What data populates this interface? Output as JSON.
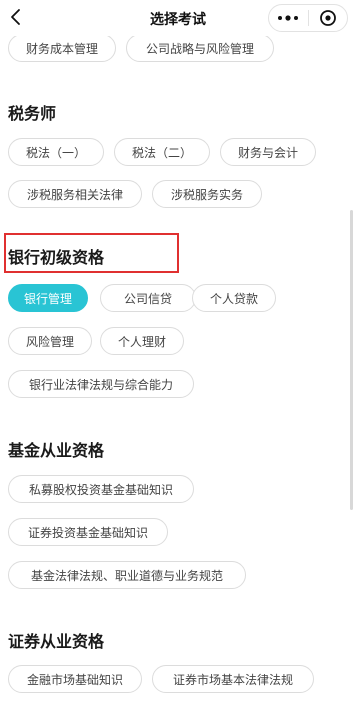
{
  "header": {
    "title": "选择考试",
    "back_icon": "chevron-left-icon",
    "more_icon": "more-dots-icon",
    "close_icon": "target-circle-icon"
  },
  "colors": {
    "selected": "#29c4d4",
    "highlight": "#e03030"
  },
  "top_partial": {
    "pills": [
      "财务成本管理",
      "公司战略与风险管理"
    ]
  },
  "sections": [
    {
      "title": "税务师",
      "pills": [
        "税法（一）",
        "税法（二）",
        "财务与会计",
        "涉税服务相关法律",
        "涉税服务实务"
      ]
    },
    {
      "title": "银行初级资格",
      "pills": [
        "银行管理",
        "公司信贷",
        "个人贷款",
        "风险管理",
        "个人理财",
        "银行业法律法规与综合能力"
      ],
      "selected": "银行管理"
    },
    {
      "title": "基金从业资格",
      "pills": [
        "私募股权投资基金基础知识",
        "证券投资基金基础知识",
        "基金法律法规、职业道德与业务规范"
      ]
    },
    {
      "title": "证券从业资格",
      "pills": [
        "金融市场基础知识",
        "证券市场基本法律法规"
      ]
    }
  ]
}
